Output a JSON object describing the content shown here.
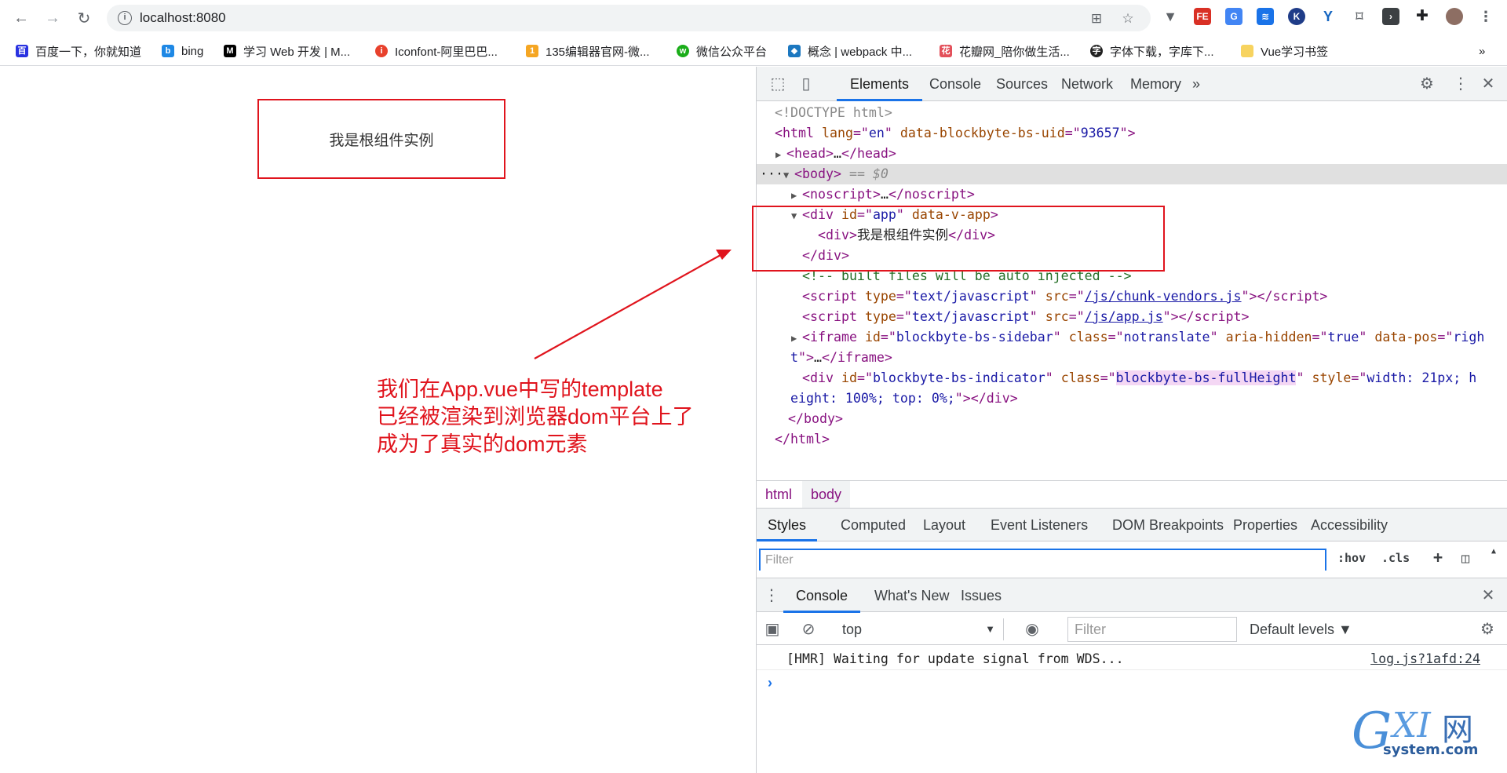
{
  "browser": {
    "url": "localhost:8080",
    "bookmarks": [
      {
        "label": "百度一下，你就知道",
        "color": "#2932e1"
      },
      {
        "label": "bing",
        "color": "#1e88e5"
      },
      {
        "label": "学习 Web 开发 | M...",
        "color": "#000000"
      },
      {
        "label": "Iconfont-阿里巴巴...",
        "color": "#e8412c"
      },
      {
        "label": "135编辑器官网-微...",
        "color": "#f5a623"
      },
      {
        "label": "微信公众平台",
        "color": "#1aad19"
      },
      {
        "label": "概念 | webpack 中...",
        "color": "#1c78c0"
      },
      {
        "label": "花瓣网_陪你做生活...",
        "color": "#e3505a"
      },
      {
        "label": "字体下载，字库下...",
        "color": "#222222"
      },
      {
        "label": "Vue学习书签",
        "color": "#f7d35f"
      }
    ],
    "more_bookmarks": "»"
  },
  "page": {
    "root_text": "我是根组件实例",
    "annotation": [
      "我们在App.vue中写的template",
      "已经被渲染到浏览器dom平台上了",
      "成为了真实的dom元素"
    ]
  },
  "devtools": {
    "tabs": [
      "Elements",
      "Console",
      "Sources",
      "Network",
      "Memory"
    ],
    "more_tabs": "»",
    "dom": {
      "doctype": "<!DOCTYPE html>",
      "html_open_tag": "html",
      "html_lang_attr": "lang",
      "html_lang_val": "en",
      "html_uid_attr": "data-blockbyte-bs-uid",
      "html_uid_val": "93657",
      "head": "head",
      "body": "body",
      "body_ref": "== $0",
      "noscript": "noscript",
      "div_app_id_attr": "id",
      "div_app_id_val": "app",
      "div_app_data_attr": "data-v-app",
      "inner_div_text": "我是根组件实例",
      "comment": "<!-- built files will be auto injected -->",
      "script1_src": "/js/chunk-vendors.js",
      "script2_src": "/js/app.js",
      "script_type": "text/javascript",
      "iframe_id": "blockbyte-bs-sidebar",
      "iframe_class": "notranslate",
      "iframe_aria": "true",
      "iframe_pos_part1": "righ",
      "iframe_pos_part2": "t",
      "indicator_id": "blockbyte-bs-indicator",
      "indicator_class": "blockbyte-bs-fullHeight",
      "indicator_style_part1": "width: 21px; h",
      "indicator_style_part2": "eight: 100%; top: 0%;"
    },
    "breadcrumbs": [
      "html",
      "body"
    ],
    "sub_tabs": [
      "Styles",
      "Computed",
      "Layout",
      "Event Listeners",
      "DOM Breakpoints",
      "Properties",
      "Accessibility"
    ],
    "styles_filter_placeholder": "Filter",
    "styles_tools": [
      ":hov",
      ".cls",
      "+"
    ],
    "drawer_tabs": [
      "Console",
      "What's New",
      "Issues"
    ],
    "console_context": "top",
    "console_filter_placeholder": "Filter",
    "console_levels": "Default levels ▼",
    "console_message": "[HMR] Waiting for update signal from WDS...",
    "console_message_source": "log.js?1afd:24",
    "prompt": "›"
  },
  "watermark": {
    "text1": "G",
    "text2": "XI",
    "text3": "网",
    "text4": "system.com"
  }
}
